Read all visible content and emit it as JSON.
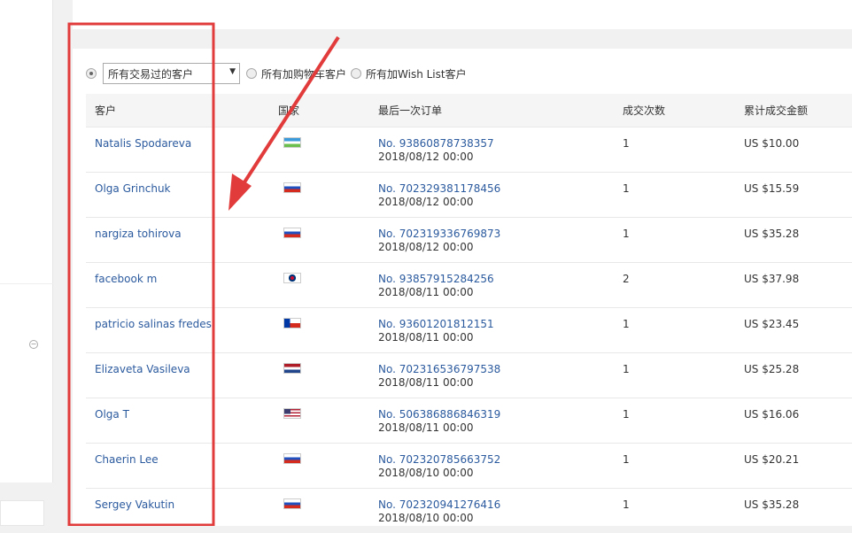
{
  "filter": {
    "options": [
      {
        "label": "所有交易过的客户",
        "selected": true
      },
      {
        "label": "所有加购物车客户",
        "selected": false
      },
      {
        "label": "所有加Wish List客户",
        "selected": false
      }
    ]
  },
  "table": {
    "headers": [
      "客户",
      "国家",
      "最后一次订单",
      "成交次数",
      "累计成交金额"
    ],
    "rows": [
      {
        "customer": "Natalis Spodareva",
        "country": "UZ",
        "order": "No. 93860878738357",
        "date": "2018/08/12 00:00",
        "count": "1",
        "amount": "US $10.00"
      },
      {
        "customer": "Olga Grinchuk",
        "country": "RU",
        "order": "No. 702329381178456",
        "date": "2018/08/12 00:00",
        "count": "1",
        "amount": "US $15.59"
      },
      {
        "customer": "nargiza tohirova",
        "country": "RU",
        "order": "No. 702319336769873",
        "date": "2018/08/12 00:00",
        "count": "1",
        "amount": "US $35.28"
      },
      {
        "customer": "facebook m",
        "country": "KR",
        "order": "No. 93857915284256",
        "date": "2018/08/11 00:00",
        "count": "2",
        "amount": "US $37.98"
      },
      {
        "customer": "patricio salinas fredes",
        "country": "CL",
        "order": "No. 93601201812151",
        "date": "2018/08/11 00:00",
        "count": "1",
        "amount": "US $23.45"
      },
      {
        "customer": "Elizaveta Vasileva",
        "country": "NL",
        "order": "No. 702316536797538",
        "date": "2018/08/11 00:00",
        "count": "1",
        "amount": "US $25.28"
      },
      {
        "customer": "Olga T",
        "country": "US",
        "order": "No. 506386886846319",
        "date": "2018/08/11 00:00",
        "count": "1",
        "amount": "US $16.06"
      },
      {
        "customer": "Chaerin Lee",
        "country": "RU",
        "order": "No. 702320785663752",
        "date": "2018/08/10 00:00",
        "count": "1",
        "amount": "US $20.21"
      },
      {
        "customer": "Sergey Vakutin",
        "country": "RU",
        "order": "No. 702320941276416",
        "date": "2018/08/10 00:00",
        "count": "1",
        "amount": "US $35.28"
      }
    ]
  },
  "colors": {
    "link": "#2b5a9e",
    "annotation": "#e23b3b"
  }
}
